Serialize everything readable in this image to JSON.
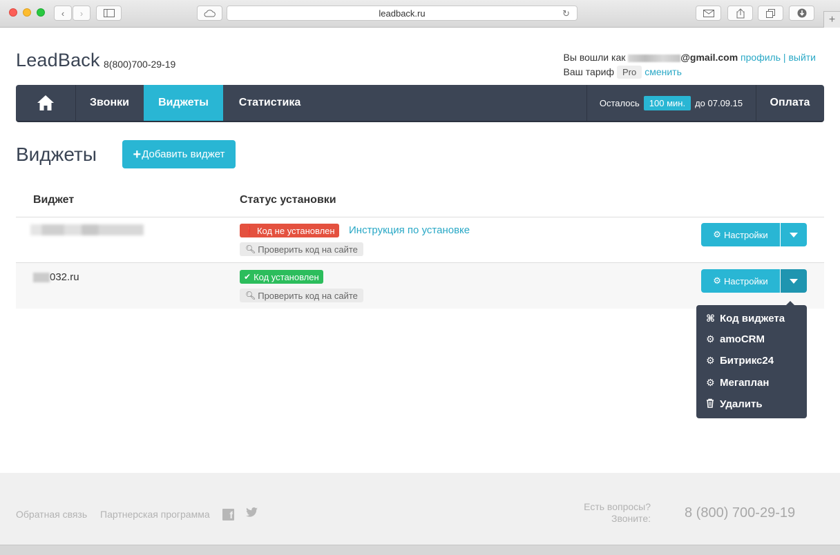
{
  "browser": {
    "url": "leadback.ru"
  },
  "header": {
    "logo": "LeadBack",
    "phone": "8(800)700-29-19",
    "logged_in_as": "Вы вошли как",
    "email_domain": "@gmail.com",
    "profile_link": "профиль",
    "divider": "|",
    "logout_link": "выйти",
    "tariff_label": "Ваш тариф",
    "tariff_value": "Pro",
    "change_link": "сменить"
  },
  "nav": {
    "calls": "Звонки",
    "widgets": "Виджеты",
    "stats": "Статистика",
    "remain_label": "Осталось",
    "remain_minutes": "100 мин.",
    "remain_until": "до 07.09.15",
    "payment": "Оплата",
    "active": "widgets"
  },
  "page": {
    "title": "Виджеты",
    "add_button": "Добавить виджет"
  },
  "table": {
    "col_widget": "Виджет",
    "col_status": "Статус установки",
    "rows": [
      {
        "site": "",
        "status": "Код не установлен",
        "instruction": "Инструкция по установке",
        "check": "Проверить код на сайте",
        "settings": "Настройки"
      },
      {
        "site": "032.ru",
        "status": "Код установлен",
        "check": "Проверить код на сайте",
        "settings": "Настройки"
      }
    ]
  },
  "dropdown": {
    "items": [
      {
        "label": "Код виджета",
        "icon": "command-icon"
      },
      {
        "label": "amoCRM",
        "icon": "gear-icon"
      },
      {
        "label": "Битрикс24",
        "icon": "gear-icon"
      },
      {
        "label": "Мегаплан",
        "icon": "gear-icon"
      },
      {
        "label": "Удалить",
        "icon": "trash-icon"
      }
    ]
  },
  "footer": {
    "feedback": "Обратная связь",
    "partner": "Партнерская программа",
    "question_line1": "Есть вопросы?",
    "question_line2": "Звоните:",
    "phone": "8 (800) 700-29-19"
  },
  "colors": {
    "accent": "#29b6d4",
    "nav_bg": "#3c4555",
    "danger": "#e4513f",
    "success": "#2cbd5c"
  }
}
